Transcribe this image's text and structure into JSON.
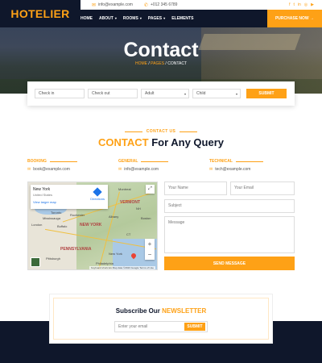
{
  "brand": {
    "name": "HOTELIER"
  },
  "topbar": {
    "email": "info@example.com",
    "phone": "+012 345 6789"
  },
  "nav": {
    "items": [
      "HOME",
      "ABOUT",
      "ROOMS",
      "PAGES",
      "ELEMENTS"
    ],
    "purchase": "PURCHASE NOW"
  },
  "hero": {
    "title": "Contact",
    "crumbs": [
      "HOME",
      "PAGES",
      "CONTACT"
    ]
  },
  "booking": {
    "checkin": "Check in",
    "checkout": "Check out",
    "adult": "Adult",
    "child": "Child",
    "submit": "SUBMIT"
  },
  "section": {
    "subtitle": "CONTACT US",
    "title_accent": "CONTACT",
    "title_rest": "For Any Query"
  },
  "contacts": [
    {
      "label": "BOOKING",
      "email": "book@example.com"
    },
    {
      "label": "GENERAL",
      "email": "info@example.com"
    },
    {
      "label": "TECHNICAL",
      "email": "tech@example.com"
    }
  ],
  "map": {
    "place": "New York",
    "region": "United States",
    "larger": "View larger map",
    "directions": "Directions",
    "labels": [
      "Ottawa",
      "Montreal",
      "Toronto",
      "Rochester",
      "Buffalo",
      "Mississauga",
      "London",
      "Albany",
      "Boston",
      "NEW YORK",
      "Pittsburgh",
      "New York",
      "Philadelphia",
      "PENNSYLVANIA",
      "VERMONT",
      "CT",
      "NH"
    ],
    "attrib": "Keyboard shortcuts   Map data ©2023 Google   Terms of Use"
  },
  "form": {
    "name": "Your Name",
    "email": "Your Email",
    "subject": "Subject",
    "message": "Message",
    "send": "SEND MESSAGE"
  },
  "newsletter": {
    "title": "Subscribe Our",
    "accent": "NEWSLETTER",
    "placeholder": "Enter your email",
    "submit": "SUBMIT"
  }
}
